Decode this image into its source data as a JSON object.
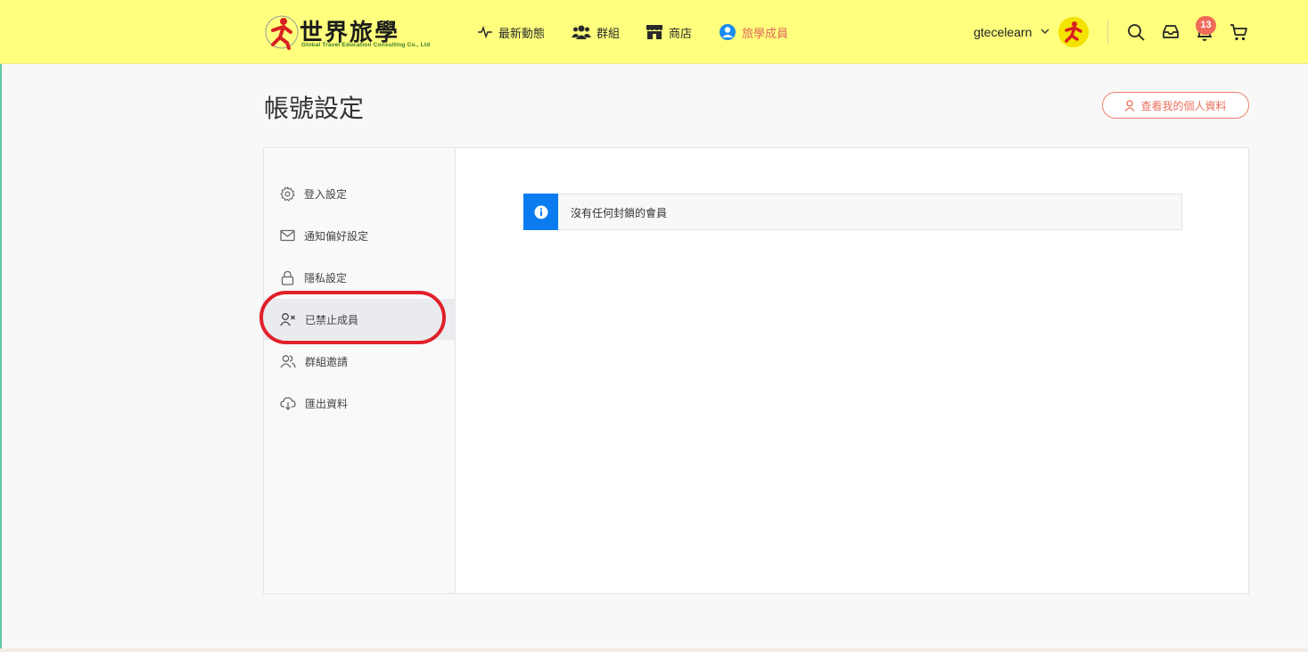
{
  "header": {
    "logo": {
      "cjk_text": "世界旅學",
      "english_text": "Global Travel Education Consulting Co., Ltd"
    },
    "nav": [
      {
        "label": "最新動態",
        "icon": "activity-icon"
      },
      {
        "label": "群組",
        "icon": "users-icon"
      },
      {
        "label": "商店",
        "icon": "store-icon"
      },
      {
        "label": "旅學成員",
        "icon": "user-circle-icon",
        "active": true
      }
    ],
    "user": {
      "name": "gtecelearn"
    },
    "notifications_count": "13",
    "colors": {
      "background": "#ffff7d",
      "active_nav": "#e06a5a",
      "badge": "#f06b5a"
    }
  },
  "page": {
    "title": "帳號設定",
    "profile_button_label": "查看我的個人資料"
  },
  "sidebar": {
    "items": [
      {
        "label": "登入設定",
        "icon": "gear-icon"
      },
      {
        "label": "通知偏好設定",
        "icon": "mail-icon"
      },
      {
        "label": "隱私設定",
        "icon": "lock-icon"
      },
      {
        "label": "已禁止成員",
        "icon": "user-x-icon",
        "active": true
      },
      {
        "label": "群組邀請",
        "icon": "users-icon"
      },
      {
        "label": "匯出資料",
        "icon": "cloud-download-icon"
      }
    ]
  },
  "main": {
    "notice": {
      "text": "沒有任何封鎖的會員",
      "icon": "info-icon",
      "accent": "#0a7cf0"
    }
  }
}
